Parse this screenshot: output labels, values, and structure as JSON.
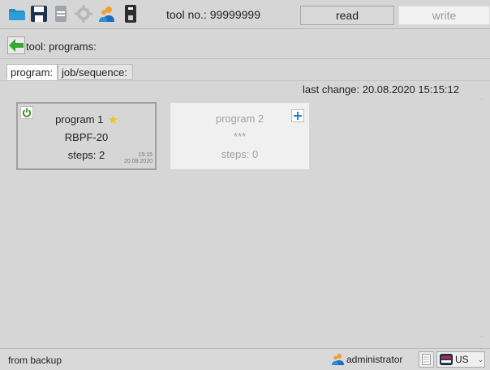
{
  "toolbar": {
    "buttons": [
      {
        "icon": "folder-open-icon"
      },
      {
        "icon": "save-icon"
      },
      {
        "icon": "printer-icon"
      },
      {
        "icon": "settings-icon"
      },
      {
        "icon": "users-icon"
      },
      {
        "icon": "usb-drive-icon"
      }
    ],
    "tool_no_label": "tool no.: 99999999",
    "read_label": "read",
    "write_label": "write"
  },
  "breadcrumb": {
    "back_icon": "arrow-left-icon",
    "label": "tool: programs:"
  },
  "tabs": [
    {
      "label": "program:",
      "active": true
    },
    {
      "label": "job/sequence:",
      "active": false
    }
  ],
  "last_change": "last change:  20.08.2020  15:15:12",
  "cards": [
    {
      "title": "program 1",
      "subtitle": "RBPF-20",
      "steps": "steps: 2",
      "time": "15:15",
      "date": "20.08.2020",
      "active": true
    },
    {
      "title": "program 2",
      "subtitle": "***",
      "steps": "steps: 0",
      "active": false
    }
  ],
  "statusbar": {
    "left_text": "from backup",
    "user": "administrator",
    "language": "US"
  },
  "colors": {
    "background": "#d6d6d6",
    "folder_blue": "#1e8bc3",
    "arrow_green": "#3aa832",
    "power_green": "#2e8b1e",
    "star_yellow": "#f3c316",
    "add_blue": "#1e7fd6"
  }
}
